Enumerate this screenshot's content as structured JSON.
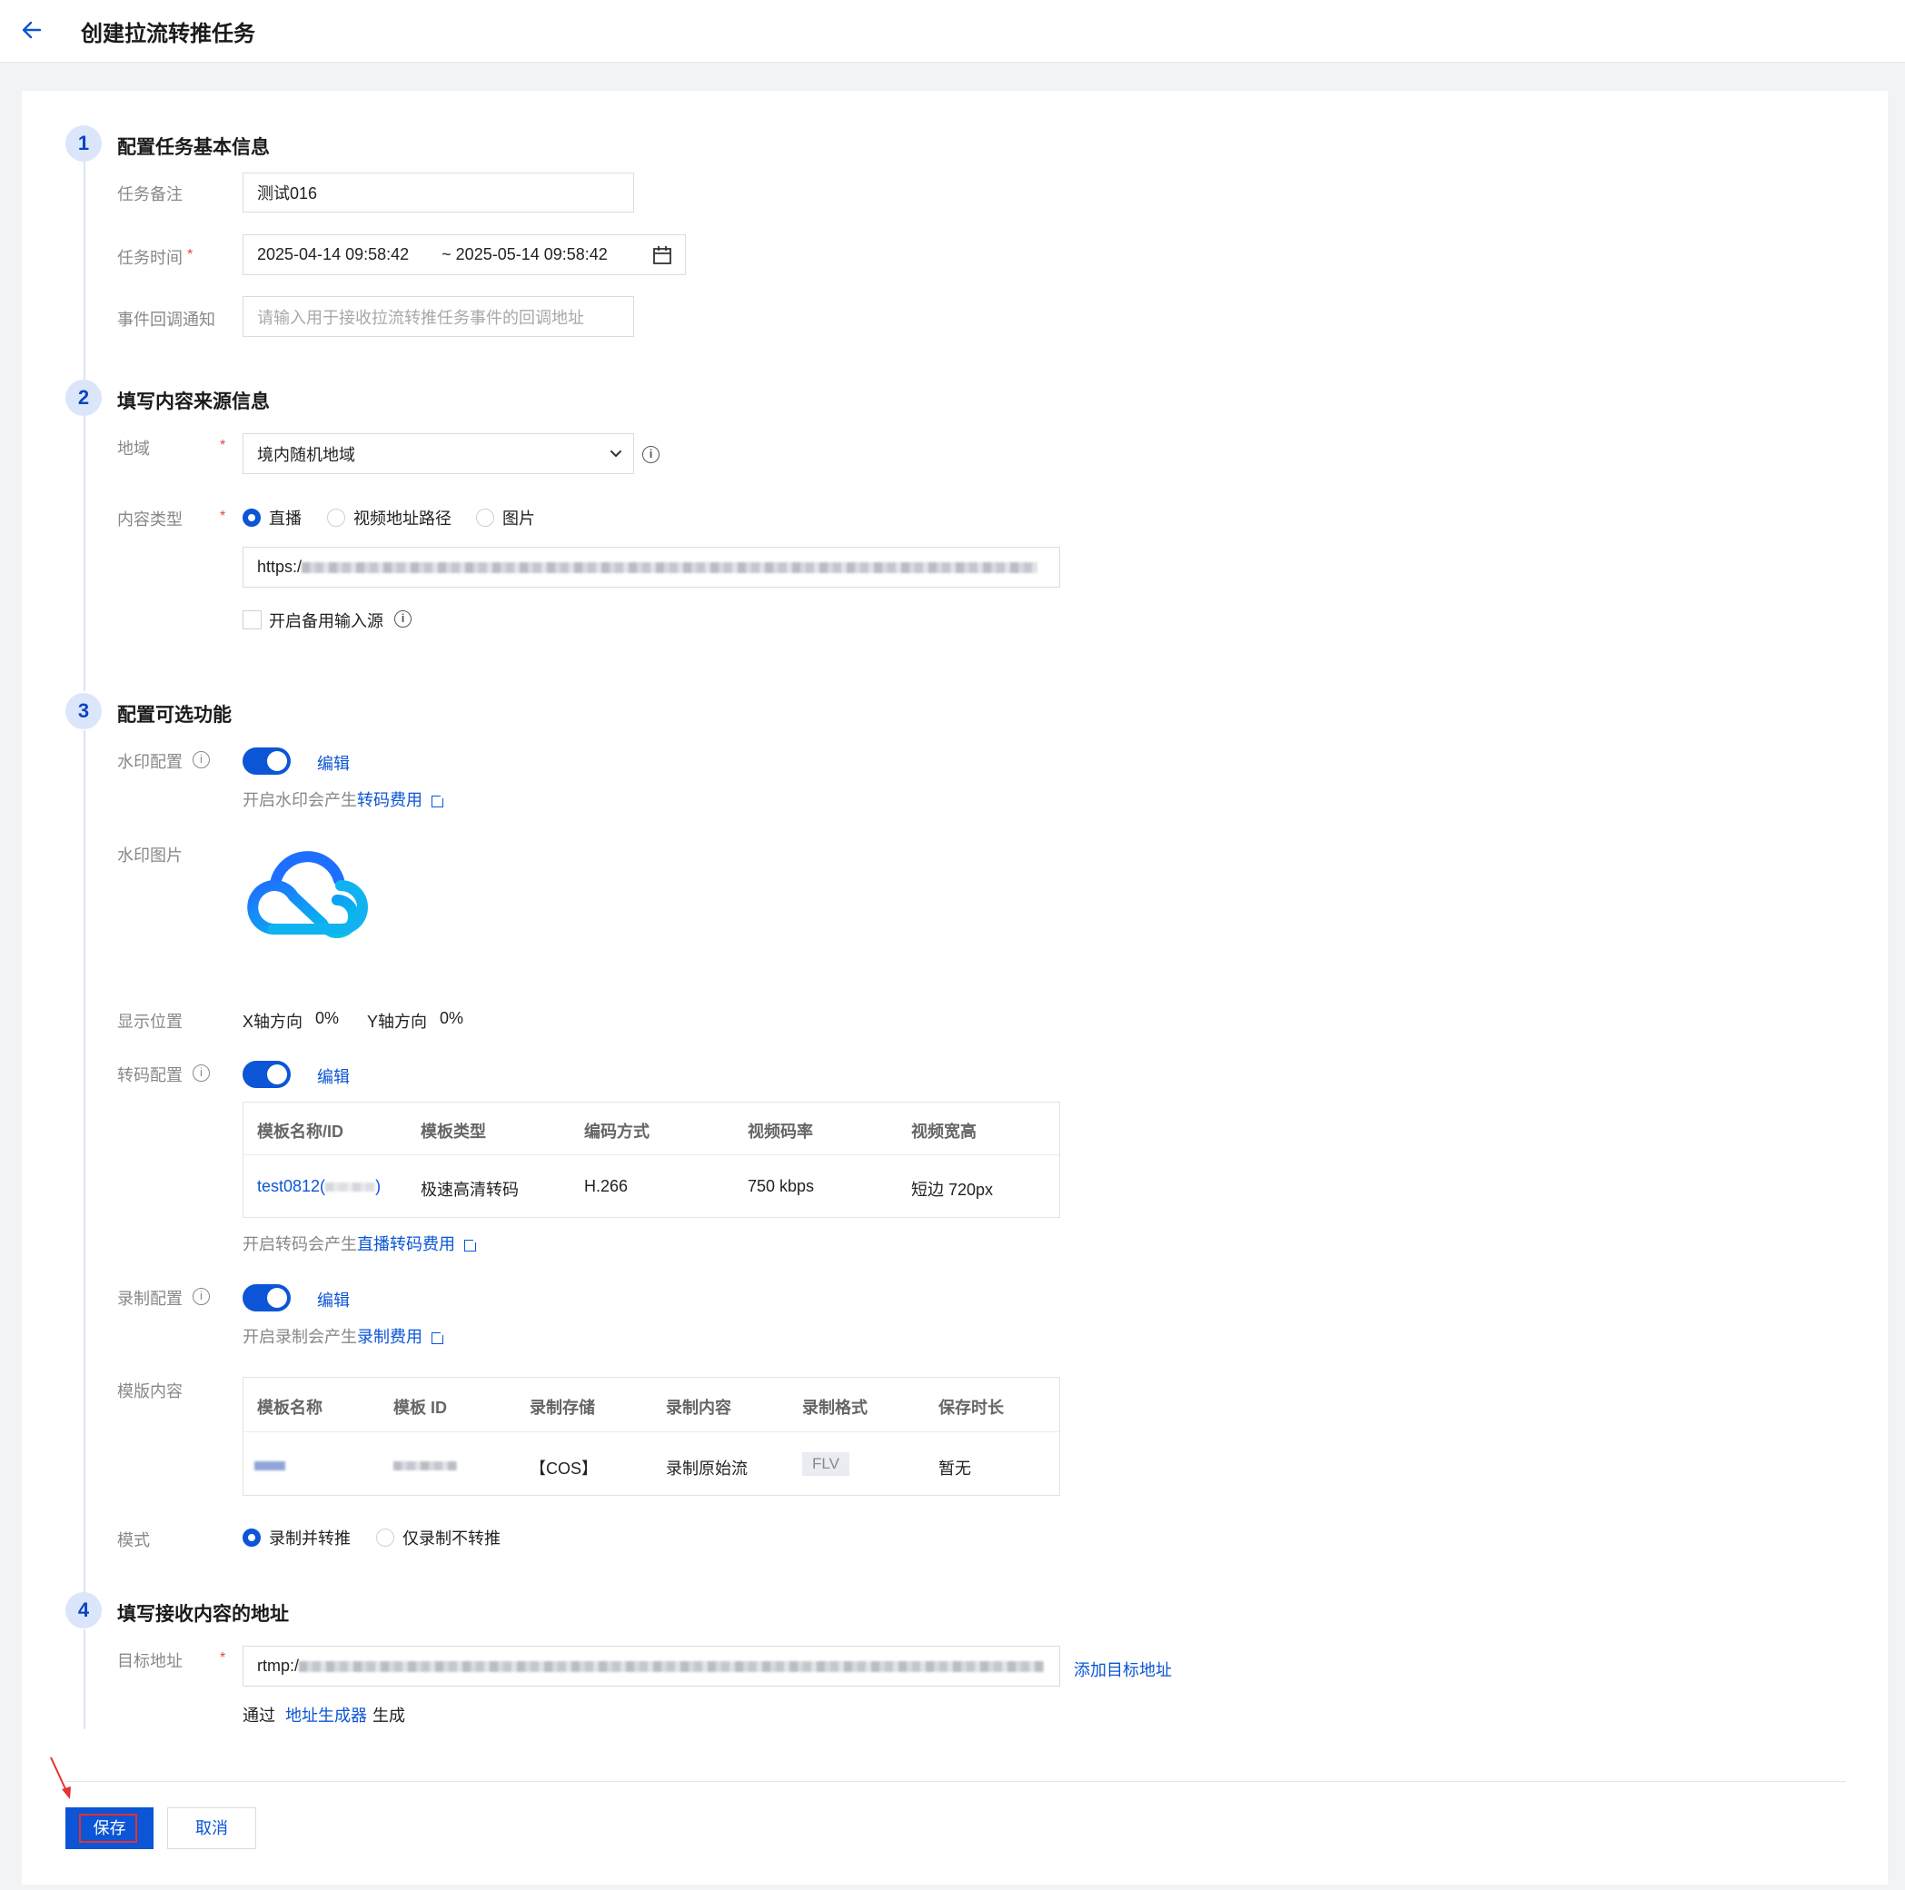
{
  "header": {
    "title": "创建拉流转推任务",
    "back_icon": "arrow-left-icon"
  },
  "steps": {
    "s1": {
      "num": "1",
      "title": "配置任务基本信息"
    },
    "s2": {
      "num": "2",
      "title": "填写内容来源信息"
    },
    "s3": {
      "num": "3",
      "title": "配置可选功能"
    },
    "s4": {
      "num": "4",
      "title": "填写接收内容的地址"
    }
  },
  "basic": {
    "note_label": "任务备注",
    "note_value": "测试016",
    "time_label": "任务时间",
    "time_start": "2025-04-14 09:58:42",
    "time_end": "~ 2025-05-14 09:58:42",
    "callback_label": "事件回调通知",
    "callback_placeholder": "请输入用于接收拉流转推任务事件的回调地址"
  },
  "source": {
    "region_label": "地域",
    "region_value": "境内随机地域",
    "type_label": "内容类型",
    "type_options": [
      "直播",
      "视频地址路径",
      "图片"
    ],
    "type_selected": "直播",
    "url_prefix": "https:/",
    "backup_label": "开启备用输入源"
  },
  "optional": {
    "watermark_label": "水印配置",
    "edit_label": "编辑",
    "watermark_note_prefix": "开启水印会产生",
    "watermark_note_link": "转码费用",
    "watermark_image_label": "水印图片",
    "position_label": "显示位置",
    "x_label": "X轴方向",
    "x_value": "0%",
    "y_label": "Y轴方向",
    "y_value": "0%",
    "transcode_label": "转码配置",
    "transcode_table": {
      "headers": [
        "模板名称/ID",
        "模板类型",
        "编码方式",
        "视频码率",
        "视频宽高"
      ],
      "row": {
        "name": "test0812(",
        "name_end": ")",
        "type": "极速高清转码",
        "codec": "H.266",
        "bitrate": "750 kbps",
        "size": "短边 720px"
      }
    },
    "transcode_note_prefix": "开启转码会产生",
    "transcode_note_link": "直播转码费用",
    "record_label": "录制配置",
    "record_note_prefix": "开启录制会产生",
    "record_note_link": "录制费用",
    "template_content_label": "模版内容",
    "record_table": {
      "headers": [
        "模板名称",
        "模板 ID",
        "录制存储",
        "录制内容",
        "录制格式",
        "保存时长"
      ],
      "row": {
        "storage": "【COS】",
        "content": "录制原始流",
        "format": "FLV",
        "duration": "暂无"
      }
    },
    "mode_label": "模式",
    "mode_options": [
      "录制并转推",
      "仅录制不转推"
    ],
    "mode_selected": "录制并转推"
  },
  "target": {
    "label": "目标地址",
    "url_prefix": "rtmp:/",
    "add_label": "添加目标地址",
    "hint_prefix": "通过",
    "hint_link": "地址生成器",
    "hint_suffix": "生成"
  },
  "footer": {
    "save_label": "保存",
    "cancel_label": "取消"
  },
  "colors": {
    "primary": "#0b55d6",
    "required": "#e54545",
    "annotation": "#e53030"
  }
}
